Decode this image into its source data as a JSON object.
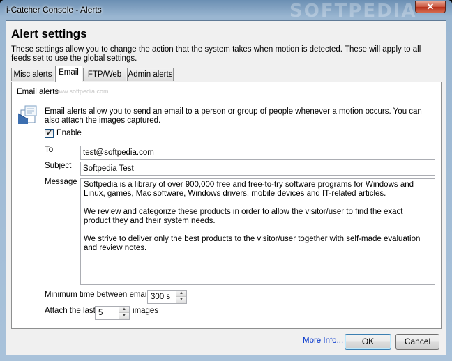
{
  "window": {
    "title": "i-Catcher Console - Alerts",
    "watermark": "SOFTPEDIA",
    "close_glyph": "✕"
  },
  "header": {
    "title": "Alert settings",
    "description": "These settings allow you to change the action that the system takes when motion is detected. These will apply to all feeds set to use the global settings."
  },
  "tabs": [
    {
      "label": "Misc alerts",
      "active": false
    },
    {
      "label": "Email",
      "active": true
    },
    {
      "label": "FTP/Web",
      "active": false
    },
    {
      "label": "Admin alerts",
      "active": false
    }
  ],
  "email_panel": {
    "group_label": "Email alerts",
    "group_watermark": "www.softpedia.com",
    "icon": "mail-envelope-icon",
    "info": "Email alerts allow you to send an email to a person or group of people whenever a motion occurs. You can also attach the images captured.",
    "enable": {
      "label": "Enable",
      "checked": true,
      "mark": "✓"
    },
    "to": {
      "label_accel": "T",
      "label_rest": "o",
      "value": "test@softpedia.com"
    },
    "subject": {
      "label_accel": "S",
      "label_rest": "ubject",
      "value": "Softpedia Test"
    },
    "message": {
      "label_accel": "M",
      "label_rest": "essage",
      "paragraphs": [
        "Softpedia is a library of over 900,000 free and free-to-try software programs for Windows and Linux, games, Mac software, Windows drivers, mobile devices and IT-related articles.",
        "We review and categorize these products in order to allow the visitor/user to find the exact product they and their system needs.",
        "We strive to deliver only the best products to the visitor/user together with self-made evaluation and review notes."
      ]
    },
    "min_time": {
      "label_accel": "M",
      "label_rest": "inimum time between emails",
      "value": "300 s"
    },
    "attach": {
      "label_accel": "A",
      "label_rest": "ttach the last",
      "value": "5",
      "suffix": "images"
    }
  },
  "spin_glyphs": {
    "up": "▲",
    "down": "▼"
  },
  "footer": {
    "more_info": "More Info...",
    "ok": "OK",
    "cancel": "Cancel"
  }
}
